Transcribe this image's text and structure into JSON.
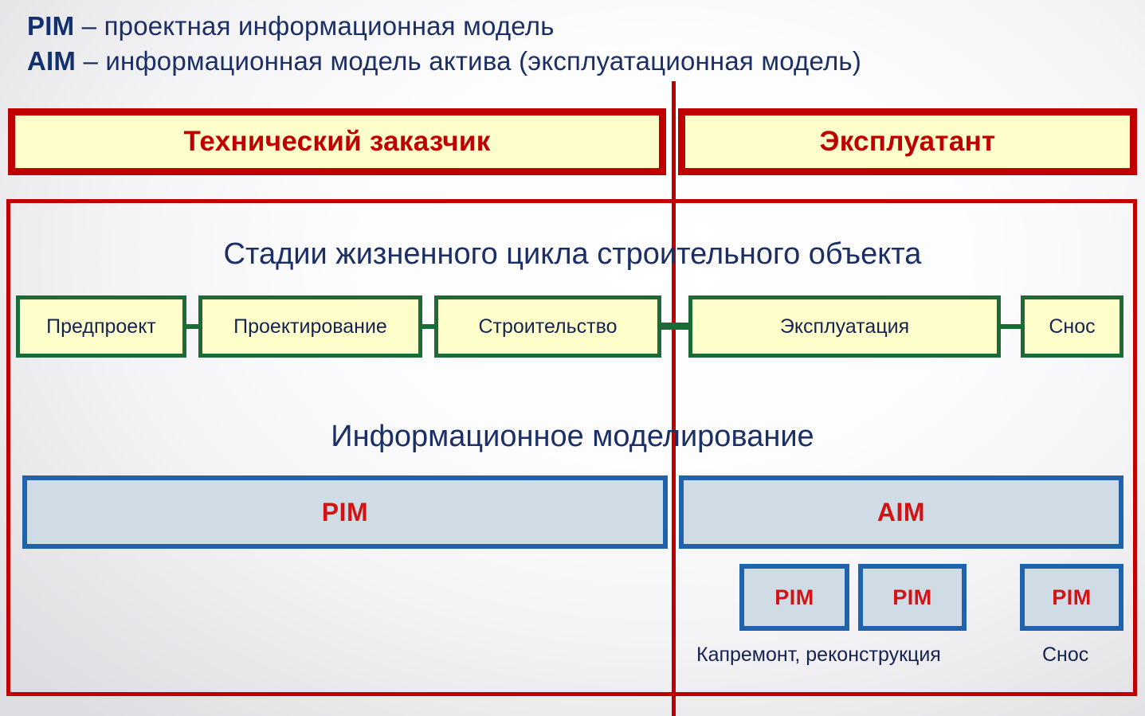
{
  "legend": {
    "line1": {
      "abbr": "PIM",
      "text": " – проектная информационная модель"
    },
    "line2": {
      "abbr": "AIM",
      "text": " – информационная модель актива (эксплуатационная модель)"
    }
  },
  "roles": {
    "left": "Технический заказчик",
    "right": "Эксплуатант"
  },
  "sections": {
    "lifecycle_title": "Стадии жизненного цикла строительного объекта",
    "modeling_title": "Информационное моделирование"
  },
  "lifecycle_stages": [
    {
      "label": "Предпроект"
    },
    {
      "label": "Проектирование"
    },
    {
      "label": "Строительство"
    },
    {
      "label": "Эксплуатация"
    },
    {
      "label": "Снос"
    }
  ],
  "models": [
    {
      "label": "PIM"
    },
    {
      "label": "AIM"
    }
  ],
  "mini_models": [
    {
      "label": "PIM"
    },
    {
      "label": "PIM"
    },
    {
      "label": "PIM"
    }
  ],
  "mini_captions": {
    "repair": "Капремонт, реконструкция",
    "demolition": "Снос"
  },
  "colors": {
    "red": "#c00000",
    "red_text": "#d31313",
    "navy": "#1b2f66",
    "green": "#1a6b36",
    "blue": "#1f63ac",
    "yellow_fill": "#ffffcc",
    "blue_fill": "#cfdce6"
  }
}
